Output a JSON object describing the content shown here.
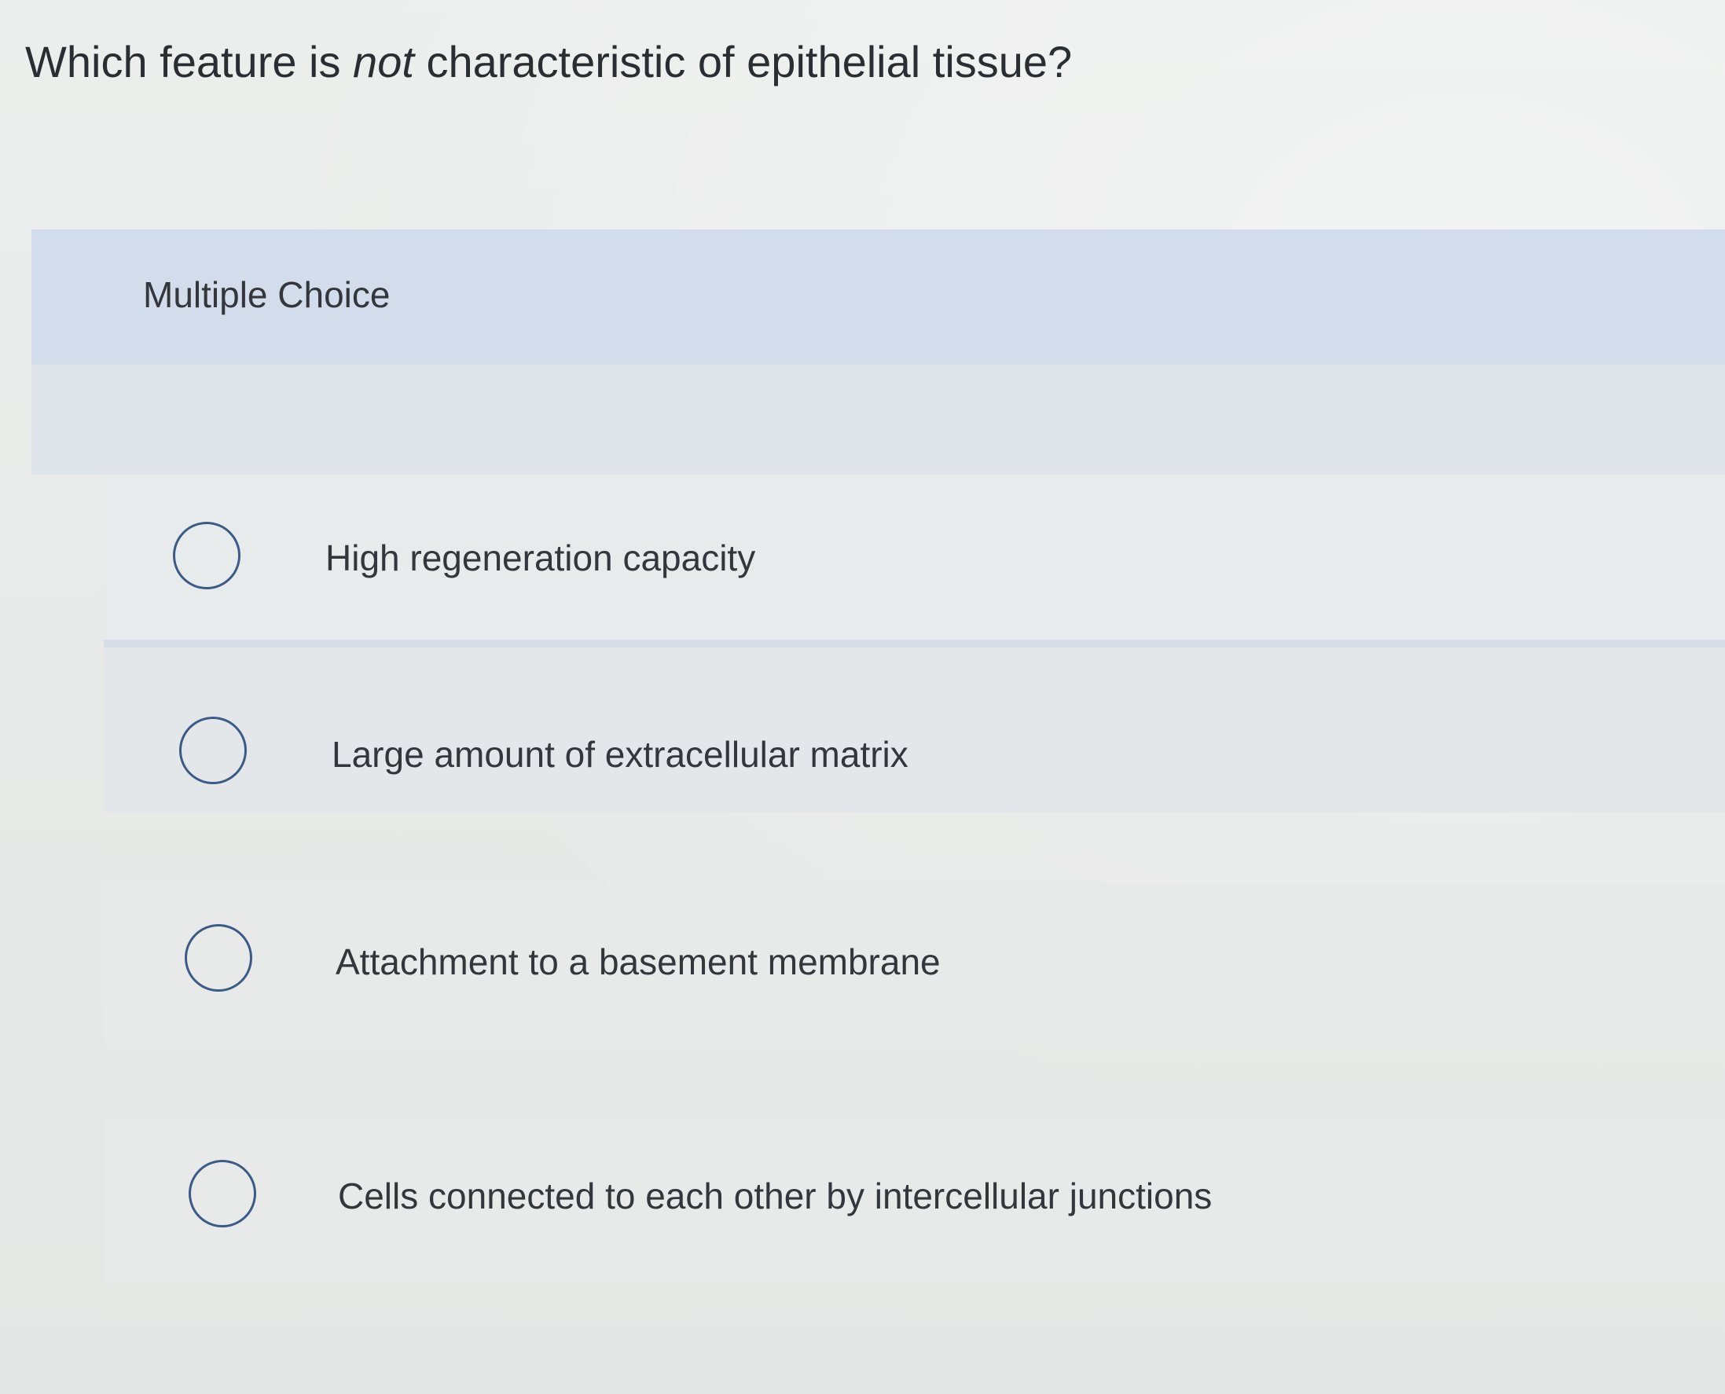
{
  "question": {
    "before": "Which feature is ",
    "emphasis": "not",
    "after": " characteristic of epithelial tissue?"
  },
  "section_label": "Multiple Choice",
  "choices": [
    {
      "label": "High regeneration capacity",
      "selected": false
    },
    {
      "label": "Large amount of extracellular matrix",
      "selected": false
    },
    {
      "label": "Attachment to a basement membrane",
      "selected": false
    },
    {
      "label": "Cells connected to each other by intercellular junctions",
      "selected": false
    }
  ],
  "colors": {
    "background": "#e9ebea",
    "header_band": "#d3dceb",
    "radio_border": "#3b5b86",
    "text": "#33373c"
  }
}
